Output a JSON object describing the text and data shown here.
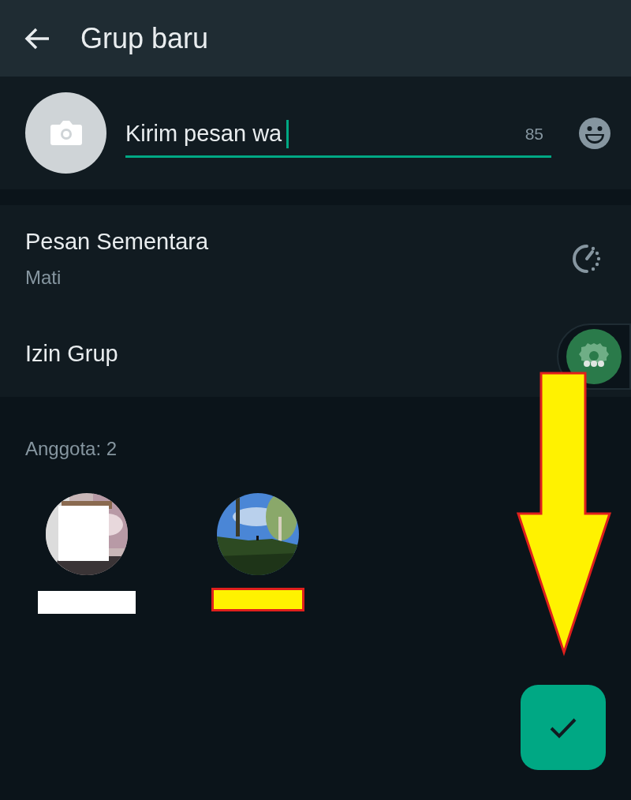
{
  "header": {
    "title": "Grup baru"
  },
  "group_name": {
    "value": "Kirim pesan wa",
    "counter": "85"
  },
  "settings": [
    {
      "kind": "timer",
      "title": "Pesan Sementara",
      "subtitle": "Mati"
    },
    {
      "kind": "permissions",
      "title": "Izin Grup"
    }
  ],
  "members_label": "Anggota: 2"
}
